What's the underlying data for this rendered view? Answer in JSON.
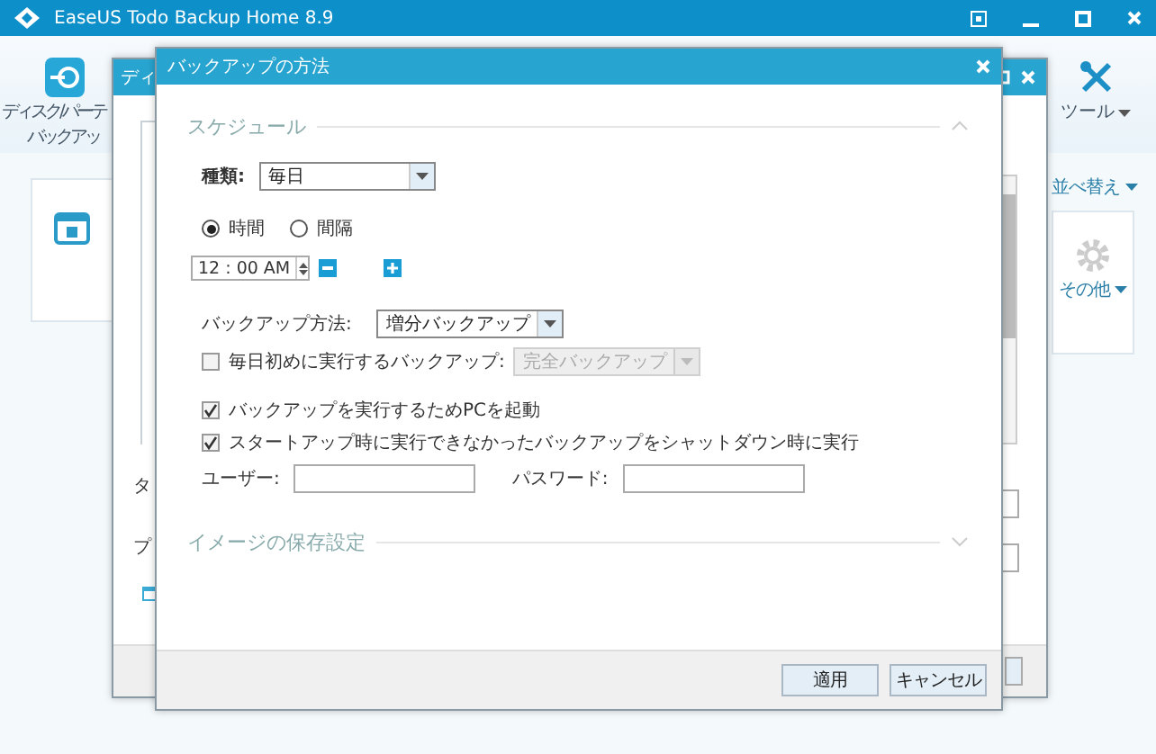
{
  "app": {
    "title": "EaseUS Todo Backup Home 8.9",
    "disk_label_lines": [
      "ディスク/パーテ",
      "バックアッ"
    ],
    "tools": "ツール",
    "sort": "並べ替え",
    "other": "その他"
  },
  "back_dialog": {
    "title": "ディ",
    "labels": [
      "タ",
      "プ"
    ],
    "checkbox": {
      "checked": false
    }
  },
  "dialog": {
    "title": "バックアップの方法",
    "sections": [
      {
        "title": "スケジュール",
        "expanded": true
      },
      {
        "title": "イメージの保存設定",
        "expanded": false
      }
    ],
    "type_label": "種類:",
    "type_value": "毎日",
    "modes": [
      {
        "label": "時間",
        "selected": true
      },
      {
        "label": "間隔",
        "selected": false
      }
    ],
    "time": "12 : 00 AM",
    "method_label": "バックアップ方法:",
    "method_value": "増分バックアップ",
    "first_backup": {
      "label": "毎日初めに実行するバックアップ:",
      "checked": false,
      "value": "完全バックアップ",
      "disabled": true
    },
    "options": [
      {
        "label": "バックアップを実行するためPCを起動",
        "checked": true
      },
      {
        "label": "スタートアップ時に実行できなかったバックアップをシャットダウン時に実行",
        "checked": true
      }
    ],
    "user_label": "ユーザー:",
    "password_label": "パスワード:",
    "buttons": [
      "適用",
      "キャンセル"
    ]
  }
}
